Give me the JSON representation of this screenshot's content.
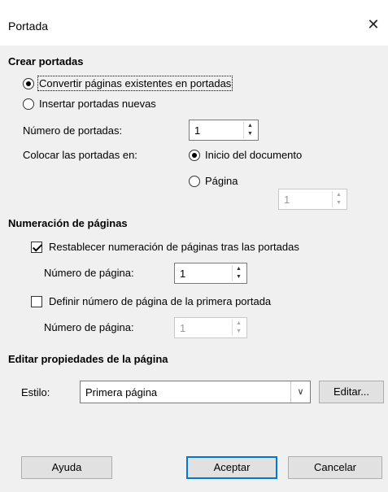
{
  "window": {
    "title": "Portada",
    "close_glyph": "✕"
  },
  "section_create": {
    "heading": "Crear portadas",
    "convert_label": "Convertir páginas existentes en portadas",
    "insert_label": "Insertar portadas nuevas",
    "convert_selected": true,
    "count_label": "Número de portadas:",
    "count_value": "1",
    "place_label": "Colocar las portadas en:",
    "start_label": "Inicio del documento",
    "start_selected": true,
    "page_label": "Página",
    "page_value": "1"
  },
  "section_numbering": {
    "heading": "Numeración de páginas",
    "reset_label": "Restablecer numeración de páginas tras las portadas",
    "reset_checked": true,
    "reset_page_label": "Número de página:",
    "reset_page_value": "1",
    "define_label": "Definir número de página de la primera portada",
    "define_checked": false,
    "define_page_label": "Número de página:",
    "define_page_value": "1"
  },
  "section_style": {
    "heading": "Editar propiedades de la página",
    "style_label": "Estilo:",
    "style_value": "Primera página",
    "edit_button": "Editar..."
  },
  "buttons": {
    "help": "Ayuda",
    "ok": "Aceptar",
    "cancel": "Cancelar"
  },
  "icons": {
    "close": "close-icon",
    "spin_up": "▲",
    "spin_down": "▼",
    "dropdown": "chevron-down-icon"
  }
}
